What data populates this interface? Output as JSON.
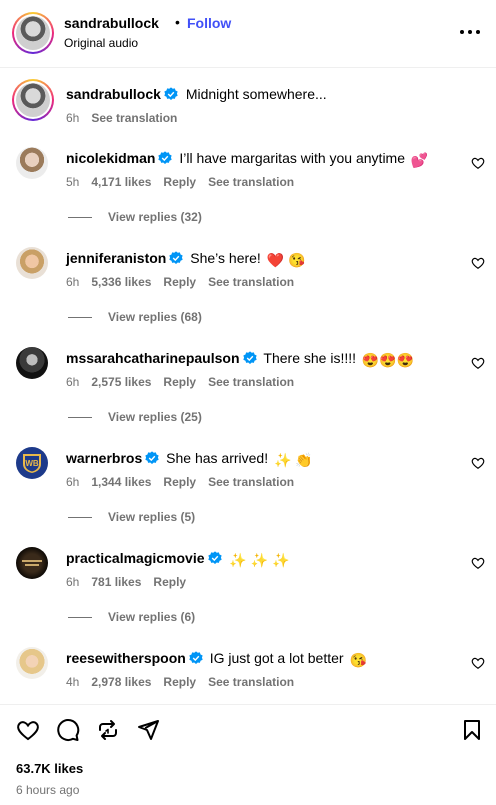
{
  "header": {
    "username": "sandrabullock",
    "separator": "•",
    "follow_label": "Follow",
    "subtitle": "Original audio"
  },
  "caption": {
    "username": "sandrabullock",
    "text": "Midnight somewhere...",
    "time": "6h",
    "see_translation": "See translation"
  },
  "comments": [
    {
      "username": "nicolekidman",
      "text": "I’ll have margaritas with you anytime",
      "emoji": "💕",
      "time": "5h",
      "likes": "4,171 likes",
      "reply": "Reply",
      "see_translation": "See translation",
      "replies": "View replies (32)"
    },
    {
      "username": "jenniferaniston",
      "text": "She’s here!",
      "emoji": "❤️ 😘",
      "time": "6h",
      "likes": "5,336 likes",
      "reply": "Reply",
      "see_translation": "See translation",
      "replies": "View replies (68)"
    },
    {
      "username": "mssarahcatharinepaulson",
      "text": "There she is!!!!",
      "emoji": "😍😍😍",
      "time": "6h",
      "likes": "2,575 likes",
      "reply": "Reply",
      "see_translation": "See translation",
      "replies": "View replies (25)"
    },
    {
      "username": "warnerbros",
      "text": "She has arrived!",
      "emoji": "✨ 👏",
      "time": "6h",
      "likes": "1,344 likes",
      "reply": "Reply",
      "see_translation": "See translation",
      "replies": "View replies (5)"
    },
    {
      "username": "practicalmagicmovie",
      "text": "",
      "emoji": "✨ ✨ ✨",
      "time": "6h",
      "likes": "781 likes",
      "reply": "Reply",
      "see_translation": "",
      "replies": "View replies (6)"
    },
    {
      "username": "reesewitherspoon",
      "text": "IG just got a lot better",
      "emoji": "😘",
      "time": "4h",
      "likes": "2,978 likes",
      "reply": "Reply",
      "see_translation": "See translation",
      "replies": ""
    }
  ],
  "footer": {
    "likes": "63.7K likes",
    "time_ago": "6 hours ago"
  },
  "colors": {
    "accent": "#4150f7",
    "verified": "#0095f6",
    "muted": "#737373"
  },
  "icons": [
    "more-icon",
    "verified-icon",
    "heart-icon",
    "comment-icon",
    "repost-icon",
    "share-icon",
    "save-icon"
  ]
}
